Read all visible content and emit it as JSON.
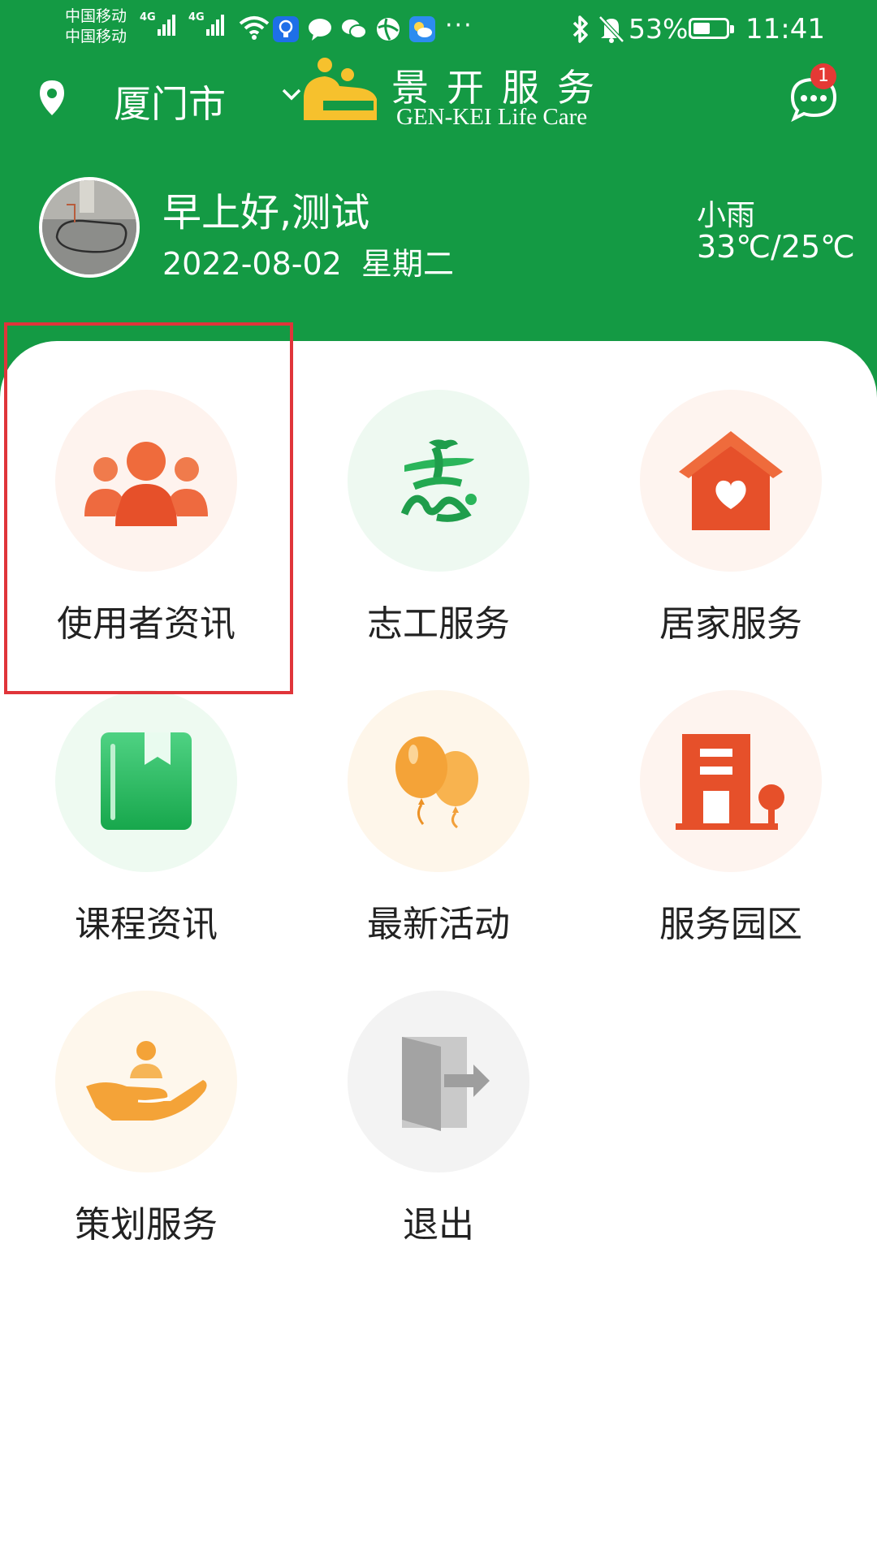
{
  "status_bar": {
    "carrier_1": "中国移动",
    "carrier_2": "中国移动",
    "network_1": "4G",
    "network_2": "4G",
    "more": "···",
    "battery": "53%",
    "battery_level": 0.53,
    "time": "11:41"
  },
  "header": {
    "city": "厦门市",
    "brand_cn": "景开服务",
    "brand_en": "GEN-KEI Life Care",
    "message_badge": "1",
    "greeting": "早上好,测试",
    "date": "2022-08-02",
    "weekday": "星期二",
    "weather": "小雨",
    "temperature": "33℃/25℃"
  },
  "menu": [
    {
      "label": "使用者资讯",
      "icon": "users-icon",
      "color": "#ed5a2c"
    },
    {
      "label": "志工服务",
      "icon": "volunteer-icon",
      "color": "#1aa84d"
    },
    {
      "label": "居家服务",
      "icon": "home-heart-icon",
      "color": "#ed5a2c"
    },
    {
      "label": "课程资讯",
      "icon": "book-icon",
      "color": "#22b559"
    },
    {
      "label": "最新活动",
      "icon": "balloons-icon",
      "color": "#f4a338"
    },
    {
      "label": "服务园区",
      "icon": "building-icon",
      "color": "#ed5a2c"
    },
    {
      "label": "策划服务",
      "icon": "hand-service-icon",
      "color": "#f4a338"
    },
    {
      "label": "退出",
      "icon": "exit-door-icon",
      "color": "#9e9e9e"
    }
  ],
  "colors": {
    "header_bg": "#149a44",
    "highlight": "#e0353a"
  }
}
